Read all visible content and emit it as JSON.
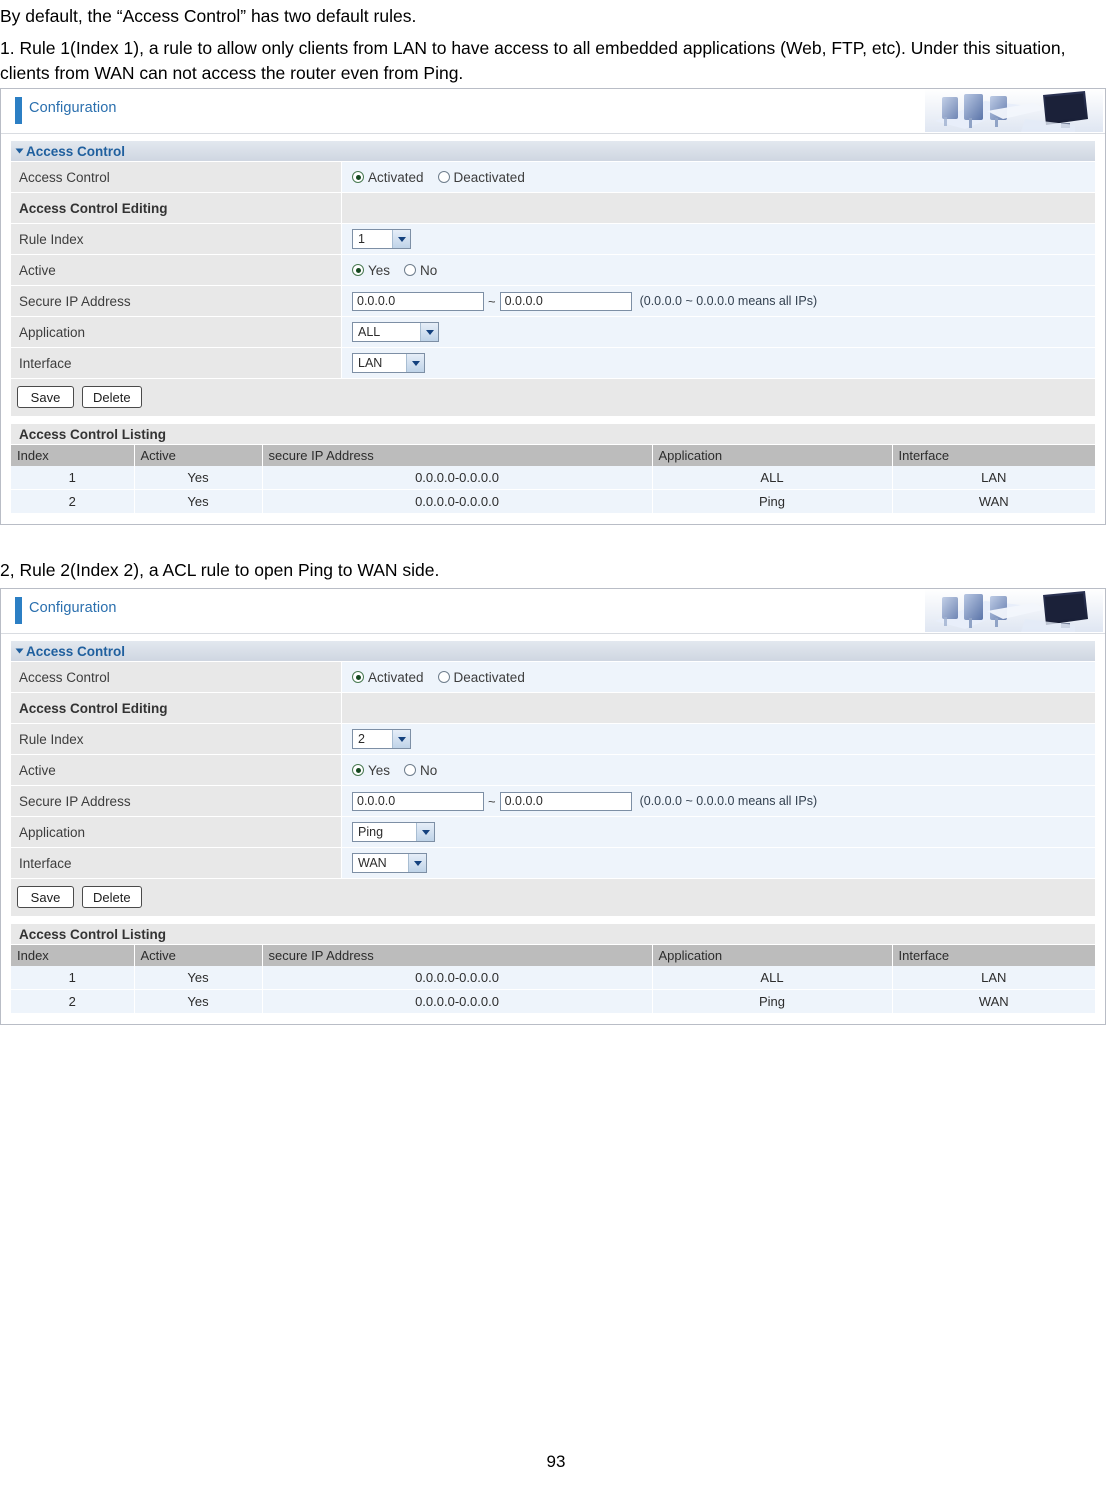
{
  "document": {
    "intro_line": "By default, the “Access Control” has two default rules.",
    "rule1_text": "1. Rule 1(Index 1), a rule to allow only clients from LAN to have access to all embedded applications (Web, FTP, etc). Under this situation, clients from WAN can not access the router even from Ping.",
    "rule2_text": "2, Rule 2(Index 2), a ACL rule to open Ping to WAN side.",
    "page_number": "93"
  },
  "panel1": {
    "header_title": "Configuration",
    "section_title": "Access Control",
    "rows": {
      "access_control_label": "Access Control",
      "activated_label": "Activated",
      "deactivated_label": "Deactivated",
      "editing_label": "Access Control Editing",
      "rule_index_label": "Rule Index",
      "rule_index_value": "1",
      "active_label": "Active",
      "yes_label": "Yes",
      "no_label": "No",
      "secure_ip_label": "Secure IP Address",
      "secure_ip_from": "0.0.0.0",
      "secure_ip_to": "0.0.0.0",
      "tilde": "~",
      "secure_ip_hint": "(0.0.0.0 ~ 0.0.0.0 means all IPs)",
      "application_label": "Application",
      "application_value": "ALL",
      "interface_label": "Interface",
      "interface_value": "LAN"
    },
    "buttons": {
      "save": "Save",
      "delete": "Delete"
    },
    "listing": {
      "title": "Access Control Listing",
      "columns": [
        "Index",
        "Active",
        "secure IP Address",
        "Application",
        "Interface"
      ],
      "rows": [
        [
          "1",
          "Yes",
          "0.0.0.0-0.0.0.0",
          "ALL",
          "LAN"
        ],
        [
          "2",
          "Yes",
          "0.0.0.0-0.0.0.0",
          "Ping",
          "WAN"
        ]
      ]
    }
  },
  "panel2": {
    "header_title": "Configuration",
    "section_title": "Access Control",
    "rows": {
      "access_control_label": "Access Control",
      "activated_label": "Activated",
      "deactivated_label": "Deactivated",
      "editing_label": "Access Control Editing",
      "rule_index_label": "Rule Index",
      "rule_index_value": "2",
      "active_label": "Active",
      "yes_label": "Yes",
      "no_label": "No",
      "secure_ip_label": "Secure IP Address",
      "secure_ip_from": "0.0.0.0",
      "secure_ip_to": "0.0.0.0",
      "tilde": "~",
      "secure_ip_hint": "(0.0.0.0 ~ 0.0.0.0 means all IPs)",
      "application_label": "Application",
      "application_value": "Ping",
      "interface_label": "Interface",
      "interface_value": "WAN"
    },
    "buttons": {
      "save": "Save",
      "delete": "Delete"
    },
    "listing": {
      "title": "Access Control Listing",
      "columns": [
        "Index",
        "Active",
        "secure IP Address",
        "Application",
        "Interface"
      ],
      "rows": [
        [
          "1",
          "Yes",
          "0.0.0.0-0.0.0.0",
          "ALL",
          "LAN"
        ],
        [
          "2",
          "Yes",
          "0.0.0.0-0.0.0.0",
          "Ping",
          "WAN"
        ]
      ]
    }
  },
  "colors": {
    "accent_blue": "#2a6fae",
    "section_text": "#1f5f9e",
    "row_label_bg": "#e8e8e8",
    "row_value_bg": "#eef4fb",
    "table_header_bg": "#bcbcbc"
  }
}
